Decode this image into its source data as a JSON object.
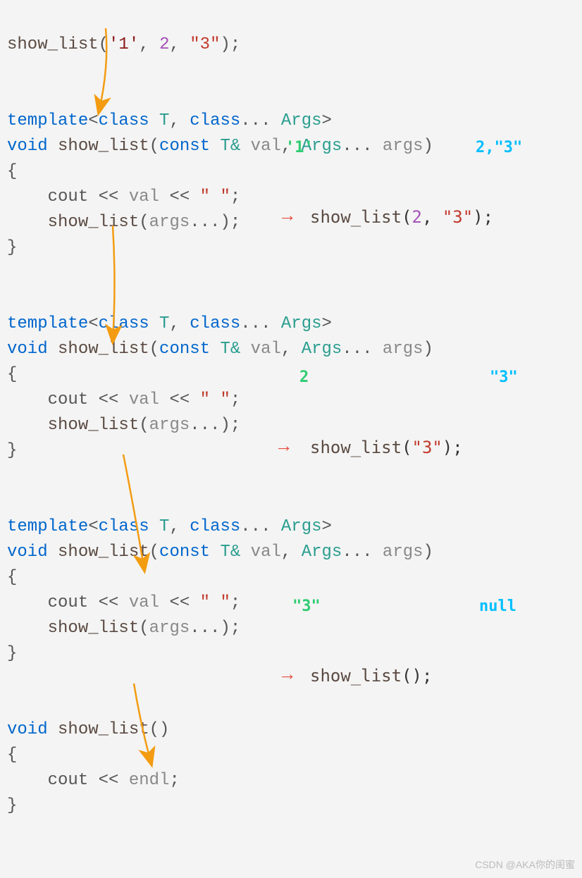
{
  "line1": {
    "fn": "show_list",
    "args_open": "(",
    "arg1": "'1'",
    "comma1": ", ",
    "arg2": "2",
    "comma2": ", ",
    "arg3": "\"3\"",
    "args_close": ");"
  },
  "block1": {
    "tmpl_open": "template",
    "tmpl_lt": "<",
    "class1": "class",
    "t1": " T",
    "comma": ", ",
    "class2": "class",
    "dots": "... ",
    "args_t": "Args",
    "tmpl_gt": ">",
    "void": "void",
    "fn": " show_list",
    "paren_open": "(",
    "const": "const",
    "tref": " T& ",
    "val": "val",
    "comma2": ", ",
    "args_p": "Args",
    "dots2": "... ",
    "args_v": "args",
    "paren_close": ")",
    "brace_open": "{",
    "indent": "    ",
    "cout": "cout << ",
    "valref": "val",
    "cout2": " << ",
    "space_str": "\" \"",
    "semi": ";",
    "call": "show_list",
    "call_open": "(",
    "call_args": "args",
    "call_dots": "...",
    "call_close": ");",
    "brace_close": "}"
  },
  "block2": {
    "brace_open": "{",
    "brace_close": "}"
  },
  "block3": {
    "brace_open": "{",
    "brace_close": "}"
  },
  "block4": {
    "void": "void",
    "fn": " show_list",
    "parens": "()",
    "brace_open": "{",
    "indent": "    ",
    "cout": "cout << ",
    "endl": "endl",
    "semi": ";",
    "brace_close": "}"
  },
  "ann": {
    "a1_val": "'1'",
    "a1_args": "2,\"3\"",
    "a2_val": "2",
    "a2_args": "\"3\"",
    "a3_val": "\"3\"",
    "a3_args": "null"
  },
  "calls": {
    "c1_fn": "show_list",
    "c1_p": "(",
    "c1_a1": "2",
    "c1_c": ", ",
    "c1_a2": "\"3\"",
    "c1_e": ");",
    "c2_fn": "show_list",
    "c2_p": "(",
    "c2_a1": "\"3\"",
    "c2_e": ");",
    "c3_fn": "show_list",
    "c3_p": "();"
  },
  "watermark": "CSDN @AKA你的闺蜜"
}
